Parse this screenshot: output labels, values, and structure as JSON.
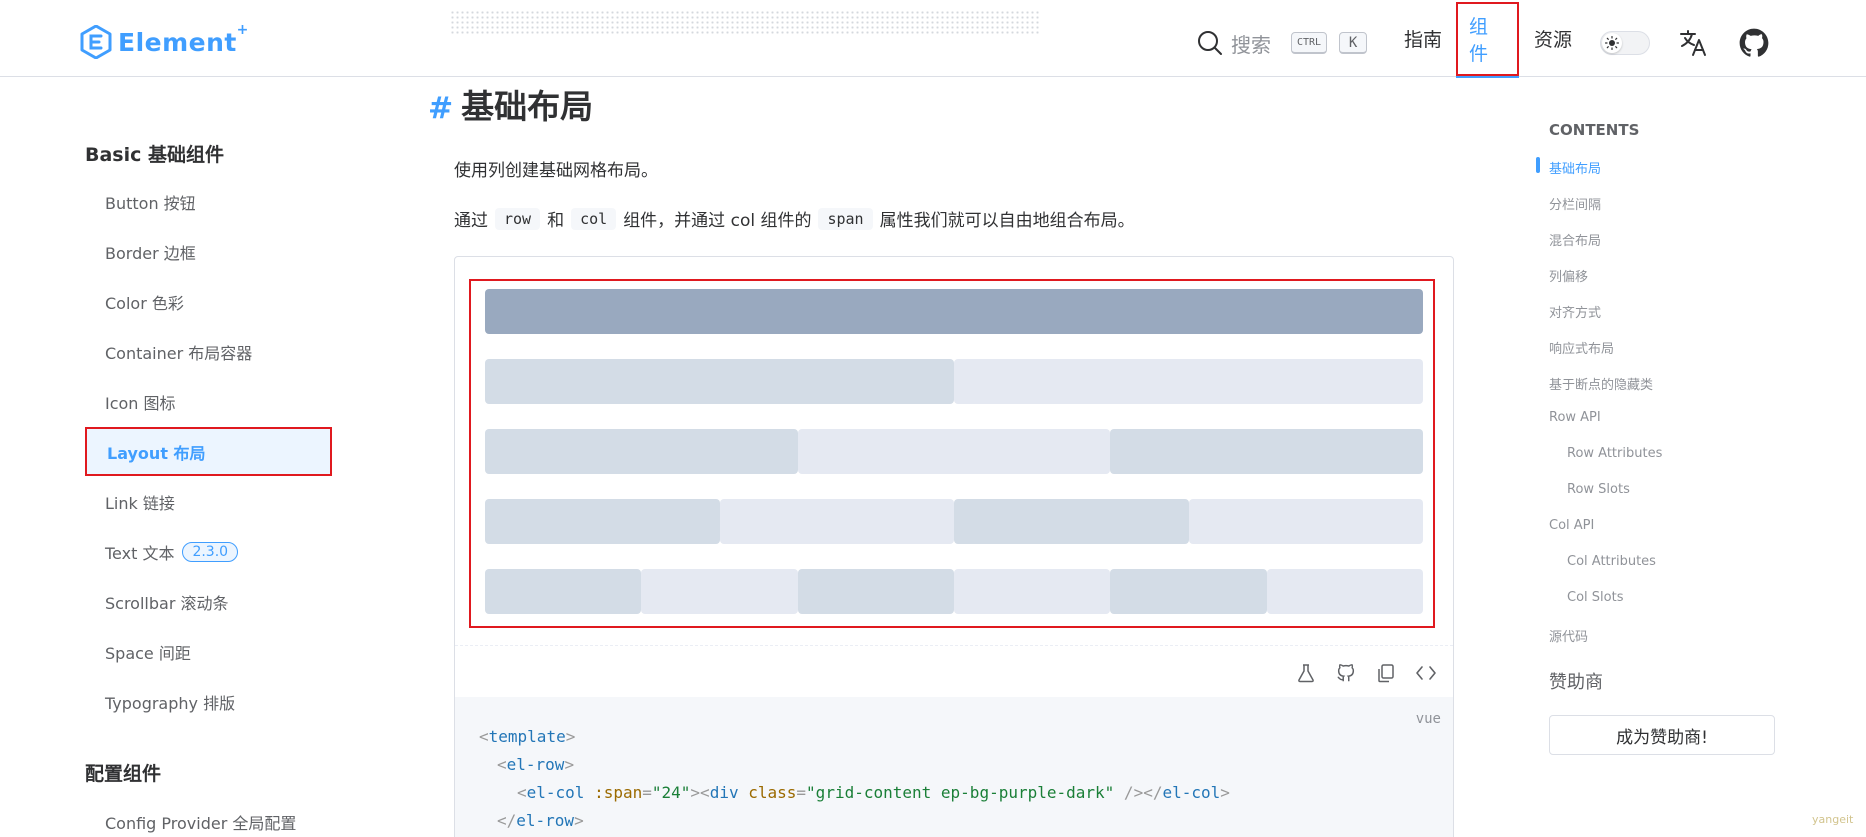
{
  "brand": {
    "name": "Element",
    "sup": "+"
  },
  "header": {
    "search_placeholder": "搜索",
    "kbd_ctrl": "CTRL",
    "kbd_k": "K",
    "nav": [
      {
        "label": "指南"
      },
      {
        "label": "组件"
      },
      {
        "label": "资源"
      }
    ]
  },
  "sidebar": {
    "group1": "Basic 基础组件",
    "items": [
      {
        "label": "Button 按钮"
      },
      {
        "label": "Border 边框"
      },
      {
        "label": "Color 色彩"
      },
      {
        "label": "Container 布局容器"
      },
      {
        "label": "Icon 图标"
      },
      {
        "label": "Layout 布局"
      },
      {
        "label": "Link 链接"
      },
      {
        "label": "Text 文本",
        "badge": "2.3.0"
      },
      {
        "label": "Scrollbar 滚动条"
      },
      {
        "label": "Space 间距"
      },
      {
        "label": "Typography 排版"
      }
    ],
    "group2": "配置组件",
    "items2": [
      {
        "label": "Config Provider 全局配置"
      }
    ]
  },
  "main": {
    "title_hash": "#",
    "title": "基础布局",
    "para1": "使用列创建基础网格布局。",
    "para2": {
      "t1": "通过",
      "c1": "row",
      "t2": "和",
      "c2": "col",
      "t3": "组件，并通过 col 组件的",
      "c3": "span",
      "t4": "属性我们就可以自由地组合布局。"
    },
    "code_lang": "vue",
    "code": {
      "l1_tag": "template",
      "l2_tag": "el-row",
      "l3_tag": "el-col",
      "l3_attr": ":span",
      "l3_val": "\"24\"",
      "l3_div": "div",
      "l3_class": "class",
      "l3_class_val": "\"grid-content ep-bg-purple-dark\"",
      "l3_close": "el-col",
      "l4_tag": "el-row"
    }
  },
  "grid_demo": {
    "rows": [
      [
        24
      ],
      [
        12,
        12
      ],
      [
        8,
        8,
        8
      ],
      [
        6,
        6,
        6,
        6
      ],
      [
        4,
        4,
        4,
        4,
        4,
        4
      ]
    ],
    "colors": {
      "dark": "#99a9bf",
      "mid": "#d3dce6",
      "light": "#e5e9f2"
    }
  },
  "toc": {
    "title": "CONTENTS",
    "items": [
      {
        "label": "基础布局",
        "level": 1
      },
      {
        "label": "分栏间隔",
        "level": 1
      },
      {
        "label": "混合布局",
        "level": 1
      },
      {
        "label": "列偏移",
        "level": 1
      },
      {
        "label": "对齐方式",
        "level": 1
      },
      {
        "label": "响应式布局",
        "level": 1
      },
      {
        "label": "基于断点的隐藏类",
        "level": 1
      },
      {
        "label": "Row API",
        "level": 1
      },
      {
        "label": "Row Attributes",
        "level": 2
      },
      {
        "label": "Row Slots",
        "level": 2
      },
      {
        "label": "Col API",
        "level": 1
      },
      {
        "label": "Col Attributes",
        "level": 2
      },
      {
        "label": "Col Slots",
        "level": 2
      },
      {
        "label": "源代码",
        "level": 1
      }
    ],
    "sponsor_title": "赞助商",
    "sponsor_button": "成为赞助商!"
  },
  "watermark": "yangeit",
  "accent_color": "#409eff",
  "highlight_color": "#e0191f"
}
